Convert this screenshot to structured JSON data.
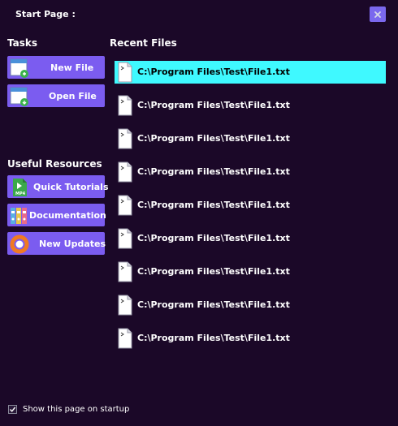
{
  "window": {
    "title": "Start Page :"
  },
  "tasks": {
    "heading": "Tasks",
    "new_file": "New File",
    "open_file": "Open File"
  },
  "resources": {
    "heading": "Useful Resources",
    "quick_tutorials": "Quick Tutorials",
    "quick_tutorials_icon_text": "MP4",
    "documentation": "Documentation",
    "new_updates": "New Updates"
  },
  "recent": {
    "heading": "Recent Files",
    "selected_index": 0,
    "files": [
      "C:\\Program Files\\Test\\File1.txt",
      "C:\\Program Files\\Test\\File1.txt",
      "C:\\Program Files\\Test\\File1.txt",
      "C:\\Program Files\\Test\\File1.txt",
      "C:\\Program Files\\Test\\File1.txt",
      "C:\\Program Files\\Test\\File1.txt",
      "C:\\Program Files\\Test\\File1.txt",
      "C:\\Program Files\\Test\\File1.txt",
      "C:\\Program Files\\Test\\File1.txt"
    ]
  },
  "startup": {
    "label": "Show this page on startup",
    "checked": true
  },
  "colors": {
    "background": "#1b0828",
    "button": "#7b5cf0",
    "selected_row": "#3ff9ff",
    "close_button": "#7b68ee"
  },
  "icons": {
    "close": "close-icon",
    "new_file": "new-file-icon",
    "open_file": "open-file-icon",
    "quick_tutorials": "video-file-icon",
    "documentation": "binders-icon",
    "new_updates": "update-ring-icon",
    "recent_file": "text-file-icon",
    "checkbox": "checkmark-icon"
  }
}
